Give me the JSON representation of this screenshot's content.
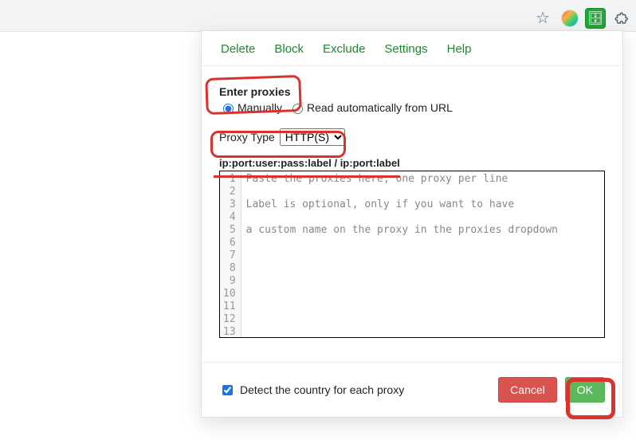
{
  "menu": {
    "delete": "Delete",
    "block": "Block",
    "exclude": "Exclude",
    "settings": "Settings",
    "help": "Help"
  },
  "section": {
    "title": "Enter proxies",
    "radio_manual": "Manually",
    "radio_auto": "Read automatically from URL"
  },
  "proxy_type": {
    "label": "Proxy Type",
    "selected": "HTTP(S)"
  },
  "format_hint": "ip:port:user:pass:label / ip:port:label",
  "editor": {
    "line1": "Paste the proxies here, one proxy per line",
    "line3": "Label is optional, only if you want to have",
    "line5": "a custom name on the proxy in the proxies dropdown"
  },
  "footer": {
    "detect_country": "Detect the country for each proxy",
    "cancel": "Cancel",
    "ok": "OK"
  }
}
